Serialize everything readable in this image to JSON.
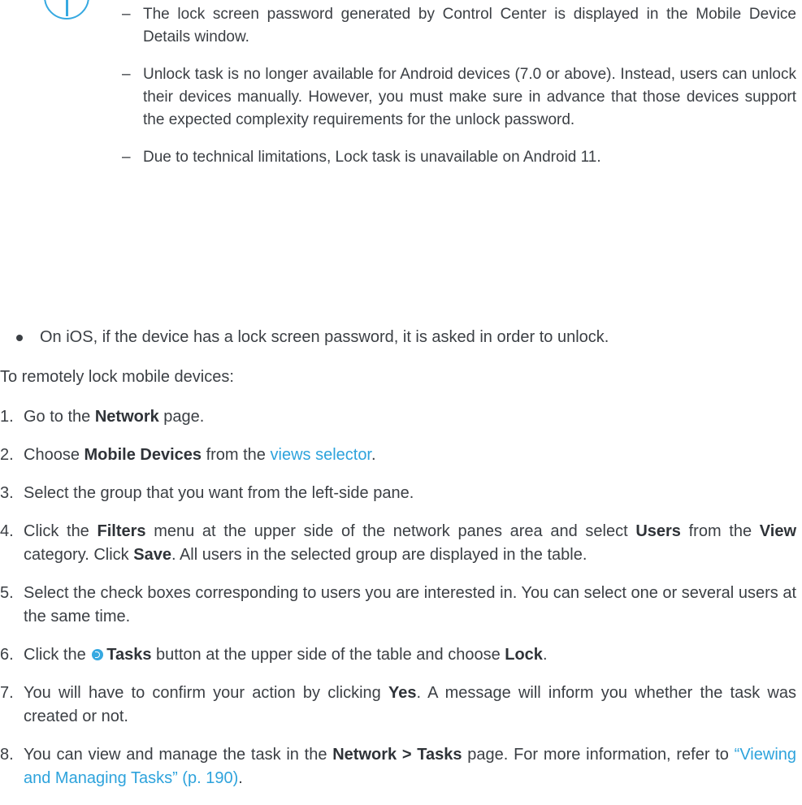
{
  "note": {
    "icon": "info-icon",
    "accent_color": "#36a9e1",
    "dash": "–",
    "items": [
      "The lock screen password generated by Control Center is displayed in the Mobile Device Details window.",
      "Unlock task is no longer available for Android devices (7.0 or above). Instead, users can unlock their devices manually. However, you must make sure in advance that those devices support the expected complexity requirements for the unlock password.",
      "Due to technical limitations, Lock task is unavailable on Android 11."
    ]
  },
  "bullet": {
    "text": "On iOS, if the device has a lock screen password, it is asked in order to unlock."
  },
  "intro": "To remotely lock mobile devices:",
  "link_color": "#2ea3dc",
  "steps": {
    "s1": {
      "num": "1.",
      "a": "Go to the ",
      "b1": "Network",
      "c": " page."
    },
    "s2": {
      "num": "2.",
      "a": "Choose ",
      "b1": "Mobile Devices",
      "c": " from the ",
      "link": "views selector",
      "d": "."
    },
    "s3": {
      "num": "3.",
      "a": "Select the group that you want from the left-side pane."
    },
    "s4": {
      "num": "4.",
      "a": "Click the ",
      "b1": "Filters",
      "c": " menu at the upper side of the network panes area and select ",
      "b2": "Users",
      "d": " from the ",
      "b3": "View",
      "e": " category. Click ",
      "b4": "Save",
      "f": ". All users in the selected group are displayed in the table."
    },
    "s5": {
      "num": "5.",
      "a": "Select the check boxes corresponding to users you are interested in. You can select one or several users at the same time."
    },
    "s6": {
      "num": "6.",
      "a": "Click the ",
      "icon": "tasks-icon",
      "b1": "Tasks",
      "c": " button at the upper side of the table and choose ",
      "b2": "Lock",
      "d": "."
    },
    "s7": {
      "num": "7.",
      "a": "You will have to confirm your action by clicking ",
      "b1": "Yes",
      "c": ". A message will inform you whether the task was created or not."
    },
    "s8": {
      "num": "8.",
      "a": "You can view and manage the task in the ",
      "b1": "Network > Tasks",
      "c": " page. For more information, refer to ",
      "link": "“Viewing and Managing Tasks” (p. 190)",
      "d": "."
    }
  }
}
